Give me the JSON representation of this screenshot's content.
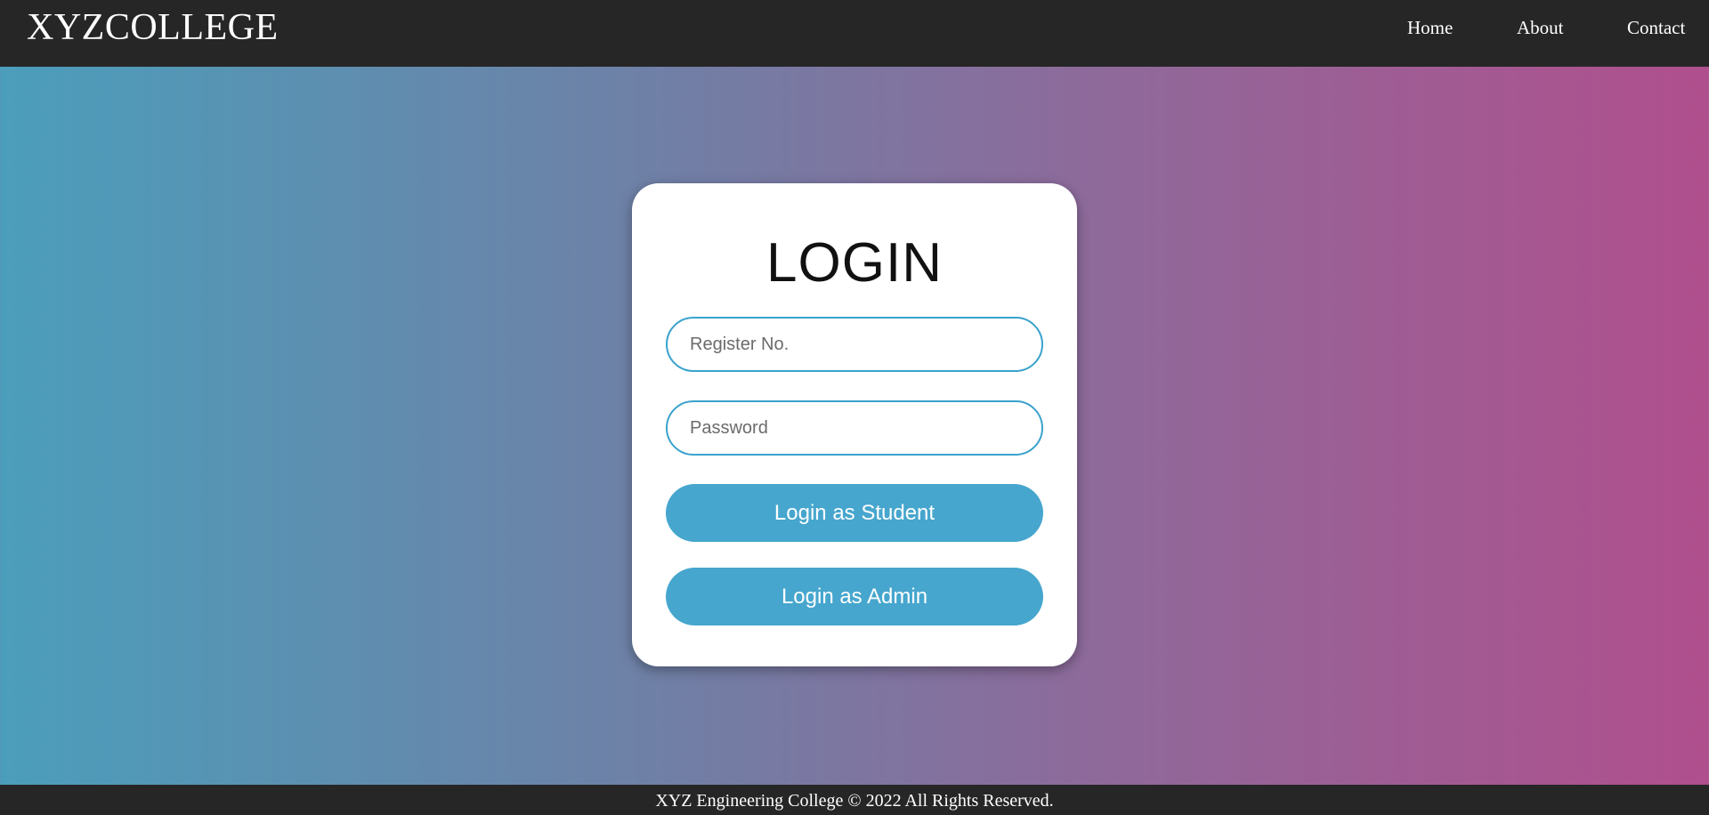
{
  "header": {
    "brand": "XYZCOLLEGE",
    "nav": {
      "home": "Home",
      "about": "About",
      "contact": "Contact"
    }
  },
  "login": {
    "title": "LOGIN",
    "register_placeholder": "Register No.",
    "password_placeholder": "Password",
    "student_button": "Login as Student",
    "admin_button": "Login as Admin"
  },
  "footer": {
    "text": "XYZ Engineering College © 2022 All Rights Reserved."
  },
  "colors": {
    "navbar": "#262626",
    "accent": "#46a6ce",
    "gradient_start": "#4b9ebb",
    "gradient_end": "#b04f8d"
  }
}
